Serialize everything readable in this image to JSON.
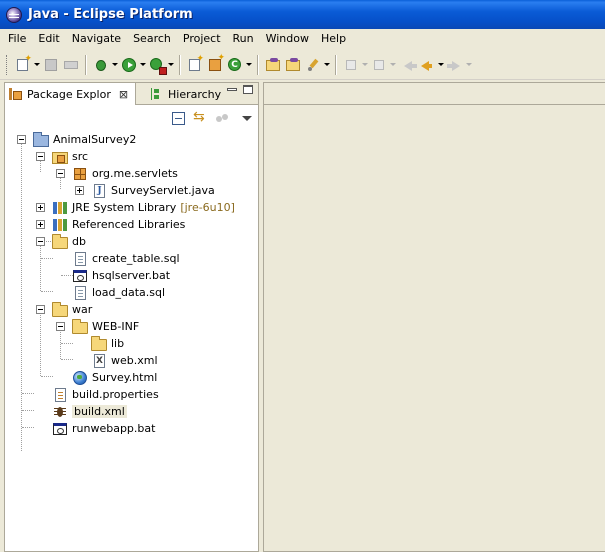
{
  "window": {
    "title": "Java - Eclipse Platform",
    "icon": "eclipse-icon"
  },
  "menu": [
    "File",
    "Edit",
    "Navigate",
    "Search",
    "Project",
    "Run",
    "Window",
    "Help"
  ],
  "view": {
    "tabs": [
      {
        "label": "Package Explor",
        "icon": "package-explorer-icon",
        "close": "⊠"
      },
      {
        "label": "Hierarchy",
        "icon": "hierarchy-icon"
      }
    ]
  },
  "tree": [
    {
      "label": "AnimalSurvey2",
      "icon": "project-folder-icon",
      "expander": "minus"
    },
    {
      "label": "src",
      "icon": "source-folder-icon",
      "expander": "minus"
    },
    {
      "label": "org.me.servlets",
      "icon": "package-icon",
      "expander": "minus"
    },
    {
      "label": "SurveyServlet.java",
      "icon": "java-file-icon",
      "expander": "plus"
    },
    {
      "label": "JRE System Library",
      "decoration": "[jre-6u10]",
      "icon": "library-icon",
      "expander": "plus"
    },
    {
      "label": "Referenced Libraries",
      "icon": "library-icon",
      "expander": "plus"
    },
    {
      "label": "db",
      "icon": "folder-icon",
      "expander": "minus"
    },
    {
      "label": "create_table.sql",
      "icon": "text-file-icon"
    },
    {
      "label": "hsqlserver.bat",
      "icon": "batch-file-icon"
    },
    {
      "label": "load_data.sql",
      "icon": "text-file-icon"
    },
    {
      "label": "war",
      "icon": "folder-icon",
      "expander": "minus"
    },
    {
      "label": "WEB-INF",
      "icon": "folder-icon",
      "expander": "minus"
    },
    {
      "label": "lib",
      "icon": "folder-icon"
    },
    {
      "label": "web.xml",
      "icon": "xml-file-icon"
    },
    {
      "label": "Survey.html",
      "icon": "html-file-icon"
    },
    {
      "label": "build.properties",
      "icon": "properties-file-icon"
    },
    {
      "label": "build.xml",
      "icon": "ant-file-icon",
      "selected": true
    },
    {
      "label": "runwebapp.bat",
      "icon": "batch-file-icon"
    }
  ]
}
